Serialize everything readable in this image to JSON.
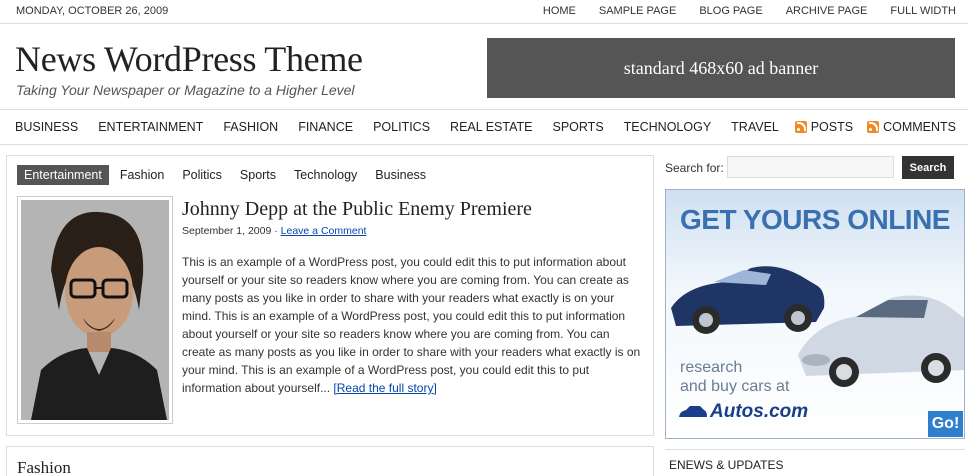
{
  "topbar": {
    "date": "MONDAY, OCTOBER 26, 2009",
    "links": [
      "HOME",
      "SAMPLE PAGE",
      "BLOG PAGE",
      "ARCHIVE PAGE",
      "FULL WIDTH"
    ]
  },
  "header": {
    "title": "News WordPress Theme",
    "description": "Taking Your Newspaper or Magazine to a Higher Level",
    "ad_banner": "standard 468x60 ad banner"
  },
  "catnav": {
    "items": [
      "BUSINESS",
      "ENTERTAINMENT",
      "FASHION",
      "FINANCE",
      "POLITICS",
      "REAL ESTATE",
      "SPORTS",
      "TECHNOLOGY",
      "TRAVEL"
    ],
    "posts": "POSTS",
    "comments": "COMMENTS"
  },
  "featured": {
    "tabs": [
      "Entertainment",
      "Fashion",
      "Politics",
      "Sports",
      "Technology",
      "Business"
    ],
    "active_tab": "Entertainment",
    "post": {
      "title": "Johnny Depp at the Public Enemy Premiere",
      "date": "September 1, 2009",
      "separator": "·",
      "comment_link": "Leave a Comment",
      "body": "This is an example of a WordPress post, you could edit this to put information about yourself or your site so readers know where you are coming from. You can create as many posts as you like in order to share with your readers what exactly is on your mind. This is an example of a WordPress post, you could edit this to put information about yourself or your site so readers know where you are coming from. You can create as many posts as you like in order to share with your readers what exactly is on your mind. This is an example of a WordPress post, you could edit this to put information about yourself...",
      "read_more": "[Read the full story]"
    }
  },
  "section2": {
    "title": "Fashion"
  },
  "sidebar": {
    "search": {
      "label": "Search for:",
      "value": "",
      "button": "Search"
    },
    "ad": {
      "headline": "GET YOURS ONLINE",
      "tagline_line1": "research",
      "tagline_line2": "and buy cars at",
      "brand": "Autos.com",
      "go": "Go!"
    },
    "enews_title": "ENEWS & UPDATES"
  },
  "colors": {
    "accent_dark": "#555555",
    "search_button": "#333333",
    "link": "#0645ad",
    "rss": "#f08a24",
    "ad_blue": "#3a6fb0"
  },
  "icons": [
    "rss-icon",
    "car-icon"
  ]
}
